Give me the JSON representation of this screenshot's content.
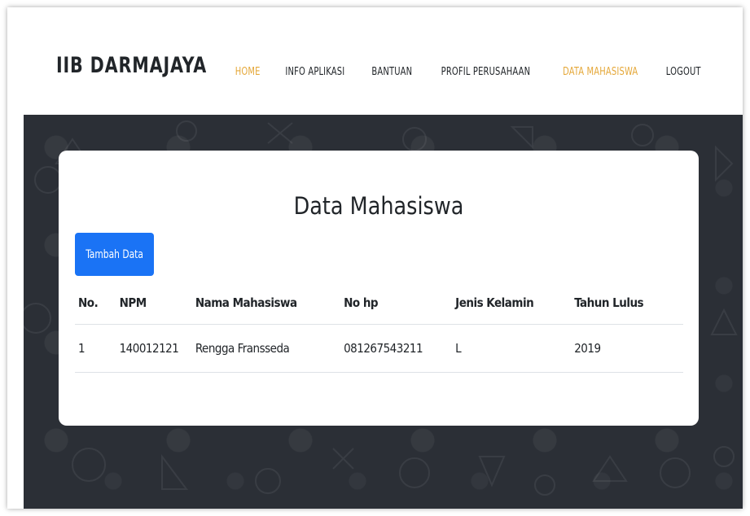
{
  "brand": "IIB DARMAJAYA",
  "nav": [
    {
      "label": "HOME",
      "active": true
    },
    {
      "label": "INFO APLIKASI",
      "active": false
    },
    {
      "label": "BANTUAN",
      "active": false
    },
    {
      "label": "PROFIL PERUSAHAAN",
      "active": false
    },
    {
      "label": "DATA MAHASISWA",
      "active": true
    },
    {
      "label": "LOGOUT",
      "active": false
    }
  ],
  "colors": {
    "accent": "#e5a83a",
    "hero_bg": "#2b2f36",
    "button": "#1a73f5"
  },
  "card": {
    "title": "Data Mahasiswa",
    "add_button": "Tambah Data"
  },
  "table": {
    "headers": [
      "No.",
      "NPM",
      "Nama Mahasiswa",
      "No hp",
      "Jenis Kelamin",
      "Tahun Lulus"
    ],
    "rows": [
      [
        "1",
        "140012121",
        "Rengga Fransseda",
        "081267543211",
        "L",
        "2019"
      ]
    ]
  }
}
